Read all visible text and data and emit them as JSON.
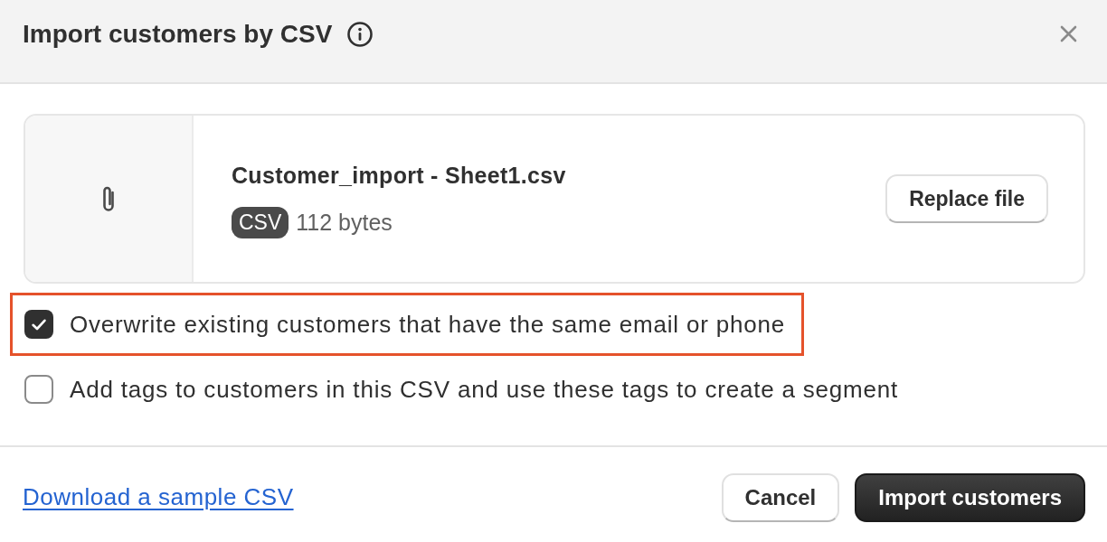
{
  "dialog": {
    "title": "Import customers by CSV"
  },
  "file": {
    "name": "Customer_import - Sheet1.csv",
    "type_badge": "CSV",
    "size": "112 bytes",
    "replace_button": "Replace file"
  },
  "options": [
    {
      "label": "Overwrite existing customers that have the same email or phone",
      "checked": true,
      "highlighted": true
    },
    {
      "label": "Add tags to customers in this CSV and use these tags to create a segment",
      "checked": false,
      "highlighted": false
    }
  ],
  "footer": {
    "link": "Download a sample CSV",
    "buttons": [
      {
        "label": "Cancel",
        "kind": "secondary"
      },
      {
        "label": "Import customers",
        "kind": "primary"
      }
    ]
  }
}
